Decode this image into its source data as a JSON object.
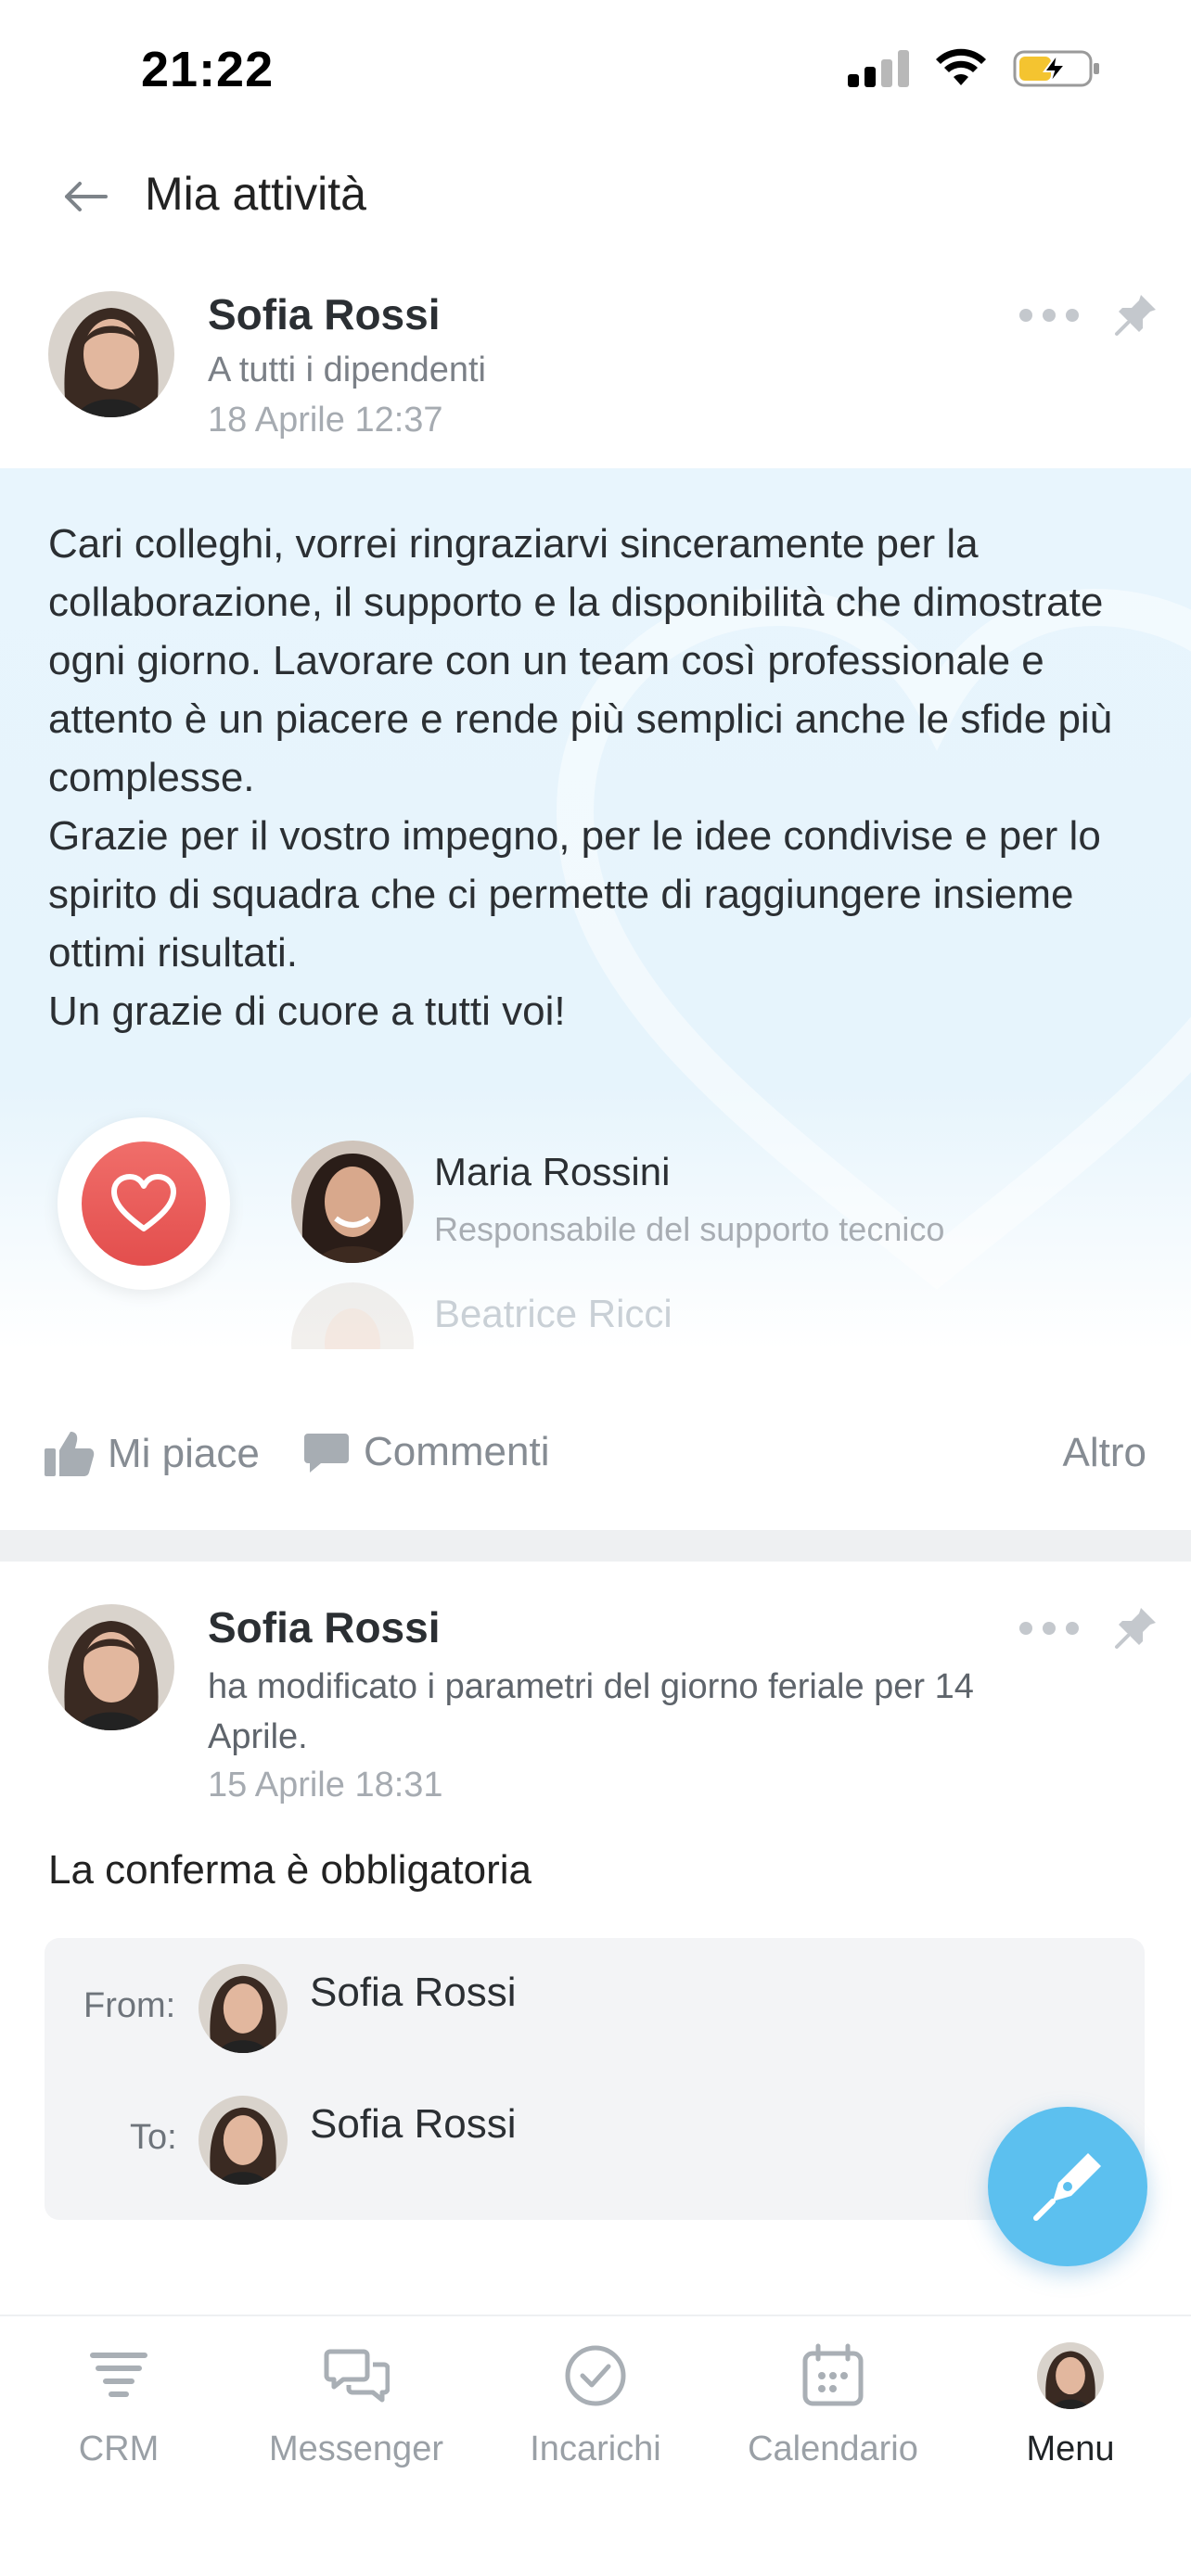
{
  "status_bar": {
    "time": "21:22"
  },
  "header": {
    "title": "Mia attività"
  },
  "post1": {
    "author": "Sofia Rossi",
    "audience": "A tutti i dipendenti",
    "date": "18 Aprile 12:37",
    "body": "Cari colleghi, vorrei ringraziarvi sinceramente per la collaborazione, il supporto e la disponibilità che dimostrate ogni giorno. Lavorare con un team così professionale e attento è un piacere e rende più semplici anche le sfide più complesse.\nGrazie per il vostro impegno, per le idee condivise e per lo spirito di squadra che ci permette di raggiungere insieme ottimi risultati.\nUn grazie di cuore a tutti voi!",
    "recipients": [
      {
        "name": "Maria Rossini",
        "role": "Responsabile del supporto tecnico"
      },
      {
        "name": "Beatrice Ricci"
      }
    ],
    "actions": {
      "like": "Mi piace",
      "comment": "Commenti",
      "more": "Altro"
    }
  },
  "post2": {
    "author": "Sofia Rossi",
    "description": "ha modificato i parametri del giorno feriale per 14 Aprile.",
    "date": "15 Aprile 18:31",
    "title": "La conferma è obbligatoria",
    "from_label": "From:",
    "from_name": "Sofia Rossi",
    "to_label": "To:",
    "to_name": "Sofia Rossi"
  },
  "tabbar": {
    "items": [
      {
        "label": "CRM",
        "icon": "crm-icon"
      },
      {
        "label": "Messenger",
        "icon": "messenger-icon"
      },
      {
        "label": "Incarichi",
        "icon": "tasks-icon"
      },
      {
        "label": "Calendario",
        "icon": "calendar-icon"
      },
      {
        "label": "Menu",
        "icon": "avatar"
      }
    ],
    "active": "Menu"
  },
  "colors": {
    "accent": "#5cc0ef",
    "heart": "#e85a58",
    "muted": "#9aa0a6"
  }
}
